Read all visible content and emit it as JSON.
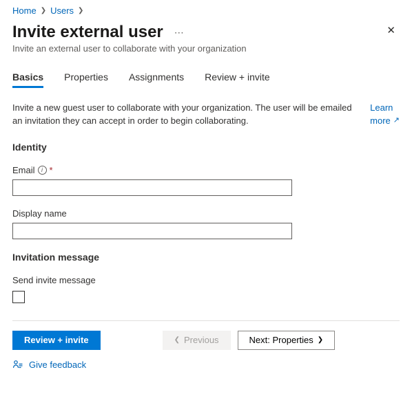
{
  "breadcrumb": {
    "items": [
      "Home",
      "Users"
    ]
  },
  "header": {
    "title": "Invite external user",
    "subtitle": "Invite an external user to collaborate with your organization"
  },
  "tabs": [
    "Basics",
    "Properties",
    "Assignments",
    "Review + invite"
  ],
  "intro": {
    "text": "Invite a new guest user to collaborate with your organization. The user will be emailed an invitation they can accept in order to begin collaborating.",
    "learn_more_1": "Learn",
    "learn_more_2": "more"
  },
  "sections": {
    "identity": "Identity",
    "invitation": "Invitation message"
  },
  "fields": {
    "email_label": "Email",
    "display_name_label": "Display name",
    "send_invite_label": "Send invite message"
  },
  "footer": {
    "review": "Review + invite",
    "previous": "Previous",
    "next": "Next: Properties",
    "feedback": "Give feedback"
  }
}
